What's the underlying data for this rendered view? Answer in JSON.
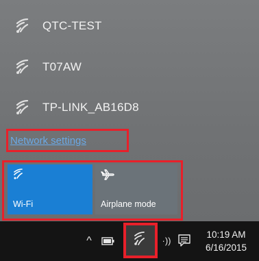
{
  "networks": [
    {
      "name": "QTC-TEST",
      "icon": "wifi-signal-icon"
    },
    {
      "name": "T07AW",
      "icon": "wifi-signal-icon"
    },
    {
      "name": "TP-LINK_AB16D8",
      "icon": "wifi-signal-icon"
    }
  ],
  "settings_link": "Network settings",
  "quick_actions": [
    {
      "label": "Wi-Fi",
      "state": "on",
      "icon": "wifi-icon"
    },
    {
      "label": "Airplane mode",
      "state": "off",
      "icon": "airplane-icon"
    }
  ],
  "taskbar": {
    "chevron": "^",
    "volume": "·))",
    "time": "10:19 AM",
    "date": "6/16/2015"
  },
  "colors": {
    "accent": "#1a7fd4",
    "highlight": "#e8202a",
    "link": "#6aa9e6"
  }
}
